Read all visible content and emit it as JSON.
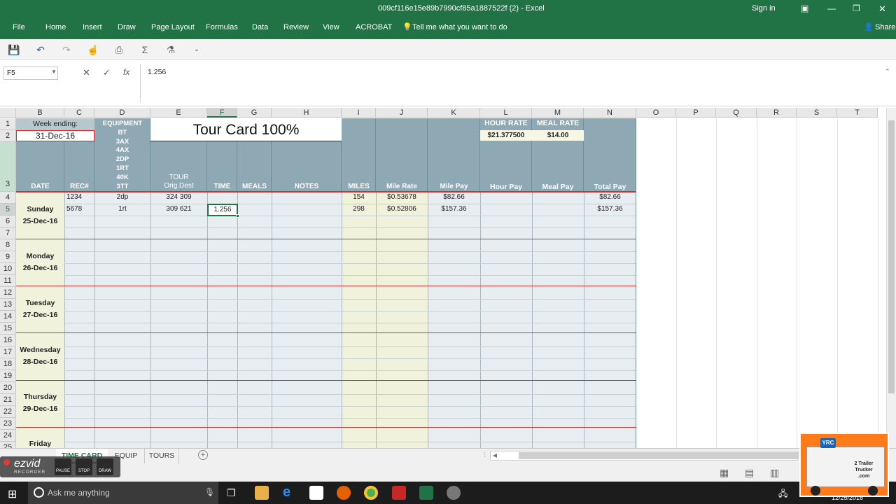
{
  "window": {
    "title": "009cf116e15e89b7990cf85a1887522f (2)  -  Excel",
    "sign_in": "Sign in",
    "share": "Share"
  },
  "menu": [
    "File",
    "Home",
    "Insert",
    "Draw",
    "Page Layout",
    "Formulas",
    "Data",
    "Review",
    "View",
    "ACROBAT"
  ],
  "tell_me": "Tell me what you want to do",
  "formula_bar": {
    "name_box": "F5",
    "value": "1.256"
  },
  "columns": [
    "B",
    "C",
    "D",
    "E",
    "F",
    "G",
    "H",
    "I",
    "J",
    "K",
    "L",
    "M",
    "N",
    "O",
    "P",
    "Q",
    "R",
    "S",
    "T"
  ],
  "rows": [
    "1",
    "2",
    "3",
    "4",
    "5",
    "6",
    "7",
    "8",
    "9",
    "10",
    "11",
    "12",
    "13",
    "14",
    "15",
    "16",
    "17",
    "18",
    "19",
    "20",
    "21",
    "22",
    "23",
    "24",
    "25"
  ],
  "sheet": {
    "week_ending_label": "Week ending:",
    "week_ending_value": "31-Dec-16",
    "title": "Tour Card 100%",
    "equipment_lines": [
      "EQUIPMENT",
      "BT",
      "3AX",
      "4AX",
      "2DP",
      "1RT",
      "40K",
      "3TT"
    ],
    "tour_label_1": "TOUR",
    "tour_label_2": "Orig.Dest",
    "headers": {
      "date": "DATE",
      "rec": "REC#",
      "time": "TIME",
      "meals": "MEALS",
      "notes": "NOTES",
      "miles": "MILES",
      "mile_rate": "Mile Rate",
      "mile_pay": "Mile Pay",
      "hour_pay": "Hour Pay",
      "meal_pay": "Meal Pay",
      "total_pay": "Total Pay"
    },
    "hour_rate_label": "HOUR RATE",
    "hour_rate_value": "$21.377500",
    "meal_rate_label": "MEAL RATE",
    "meal_rate_value": "$14.00",
    "data_rows": [
      {
        "rec": "1234",
        "equip": "2dp",
        "tour": "324 309",
        "time": "",
        "miles": "154",
        "rate": "$0.53678",
        "pay": "$82.66",
        "total": "$82.66"
      },
      {
        "rec": "5678",
        "equip": "1rt",
        "tour": "309 621",
        "time": "1.256",
        "miles": "298",
        "rate": "$0.52806",
        "pay": "$157.36",
        "total": "$157.36"
      }
    ],
    "days": [
      {
        "name": "Sunday",
        "date": "25-Dec-16"
      },
      {
        "name": "Monday",
        "date": "26-Dec-16"
      },
      {
        "name": "Tuesday",
        "date": "27-Dec-16"
      },
      {
        "name": "Wednesday",
        "date": "28-Dec-16"
      },
      {
        "name": "Thursday",
        "date": "29-Dec-16"
      },
      {
        "name": "Friday",
        "date": ""
      }
    ]
  },
  "tabs": [
    "TIME CARD",
    "EQUIP",
    "TOURS"
  ],
  "recorder": {
    "brand": "ezvid",
    "sub": "RECORDER",
    "pause": "PAUSE",
    "stop": "STOP",
    "draw": "DRAW"
  },
  "taskbar": {
    "search": "Ask me anything",
    "date": "12/25/2016"
  },
  "logo": {
    "line1": "2 Trailer",
    "line2": "Trucker",
    "line3": ".com",
    "badge": "YRC"
  }
}
